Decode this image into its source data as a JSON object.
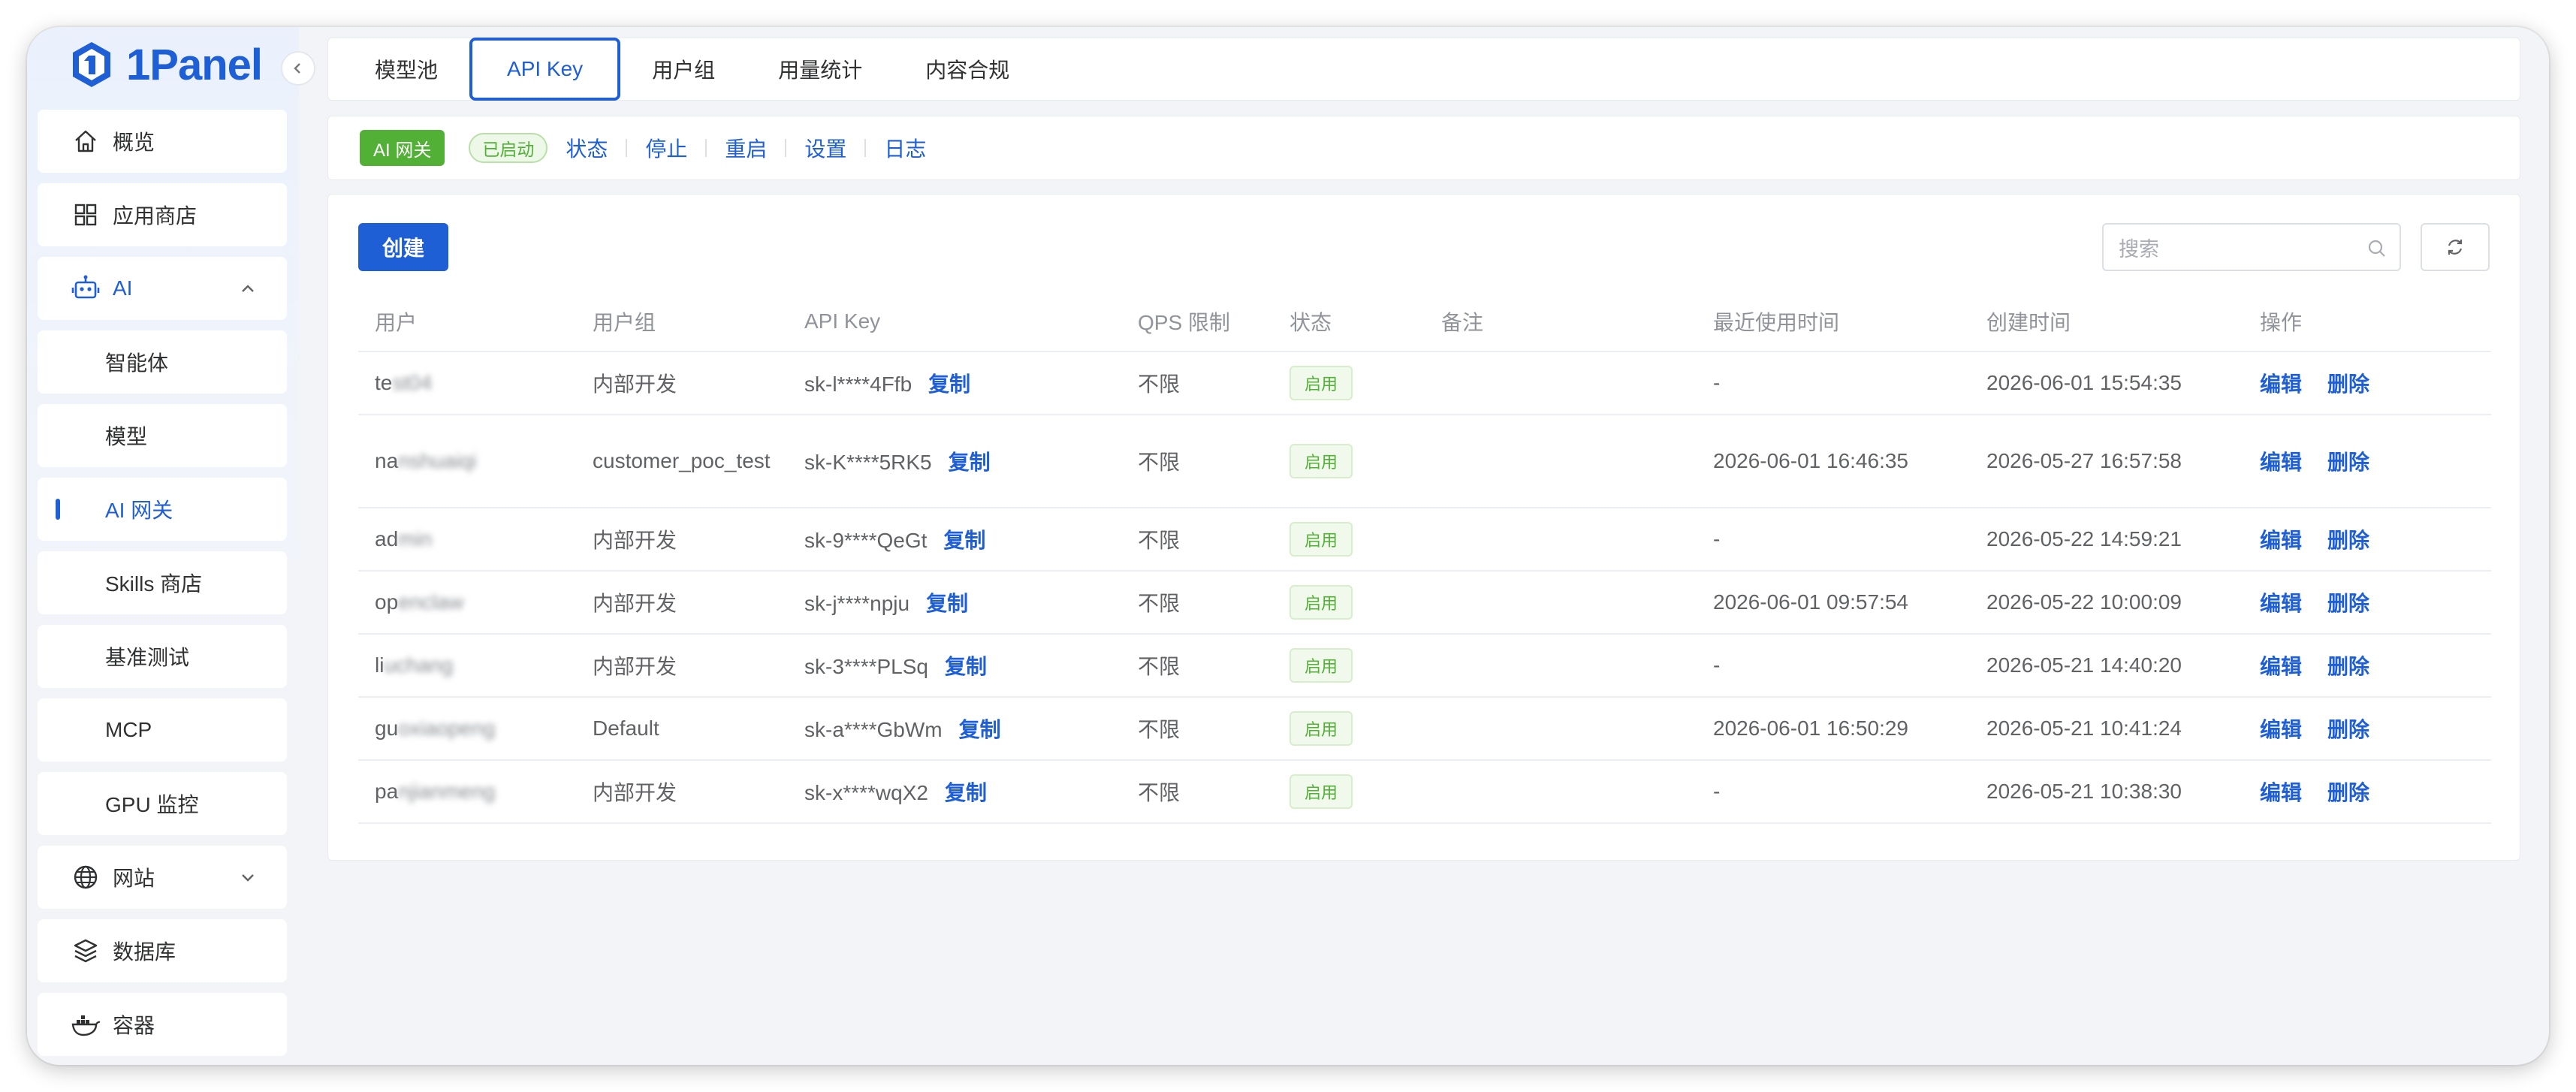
{
  "app": {
    "name": "1Panel",
    "brand_color": "#1f5fd6"
  },
  "sidebar": {
    "items": [
      {
        "label": "概览",
        "icon": "home-icon"
      },
      {
        "label": "应用商店",
        "icon": "grid-icon"
      },
      {
        "label": "AI",
        "icon": "robot-icon",
        "expanded": true
      },
      {
        "label": "智能体"
      },
      {
        "label": "模型"
      },
      {
        "label": "AI 网关",
        "active": true
      },
      {
        "label": "Skills 商店"
      },
      {
        "label": "基准测试"
      },
      {
        "label": "MCP"
      },
      {
        "label": "GPU 监控"
      },
      {
        "label": "网站",
        "icon": "globe-icon"
      },
      {
        "label": "数据库",
        "icon": "layers-icon"
      },
      {
        "label": "容器",
        "icon": "docker-icon"
      }
    ]
  },
  "tabs": [
    "模型池",
    "API Key",
    "用户组",
    "用量统计",
    "内容合规"
  ],
  "active_tab": "API Key",
  "gateway": {
    "tag": "AI 网关",
    "status": "已启动",
    "actions": [
      "状态",
      "停止",
      "重启",
      "设置",
      "日志"
    ]
  },
  "toolbar": {
    "create_label": "创建",
    "search_placeholder": "搜索"
  },
  "table": {
    "columns": [
      "用户",
      "用户组",
      "API Key",
      "QPS 限制",
      "状态",
      "备注",
      "最近使用时间",
      "创建时间",
      "操作"
    ],
    "copy_label": "复制",
    "edit_label": "编辑",
    "delete_label": "删除",
    "rows": [
      {
        "user_visible": "te",
        "user_blurred": "st04",
        "group": "内部开发",
        "key": "sk-l****4Ffb",
        "qps": "不限",
        "status": "启用",
        "note": "",
        "last_used": "-",
        "created": "2026-06-01 15:54:35"
      },
      {
        "user_visible": "na",
        "user_blurred": "nshuaiqi",
        "group": "customer_poc_test",
        "key": "sk-K****5RK5",
        "qps": "不限",
        "status": "启用",
        "note": "",
        "last_used": "2026-06-01 16:46:35",
        "created": "2026-05-27 16:57:58"
      },
      {
        "user_visible": "ad",
        "user_blurred": "min",
        "group": "内部开发",
        "key": "sk-9****QeGt",
        "qps": "不限",
        "status": "启用",
        "note": "",
        "last_used": "-",
        "created": "2026-05-22 14:59:21"
      },
      {
        "user_visible": "op",
        "user_blurred": "enclaw",
        "group": "内部开发",
        "key": "sk-j****npju",
        "qps": "不限",
        "status": "启用",
        "note": "",
        "last_used": "2026-06-01 09:57:54",
        "created": "2026-05-22 10:00:09"
      },
      {
        "user_visible": "li",
        "user_blurred": "uchang",
        "group": "内部开发",
        "key": "sk-3****PLSq",
        "qps": "不限",
        "status": "启用",
        "note": "",
        "last_used": "-",
        "created": "2026-05-21 14:40:20"
      },
      {
        "user_visible": "gu",
        "user_blurred": "oxiaopeng",
        "group": "Default",
        "key": "sk-a****GbWm",
        "qps": "不限",
        "status": "启用",
        "note": "",
        "last_used": "2026-06-01 16:50:29",
        "created": "2026-05-21 10:41:24"
      },
      {
        "user_visible": "pa",
        "user_blurred": "njianmeng",
        "group": "内部开发",
        "key": "sk-x****wqX2",
        "qps": "不限",
        "status": "启用",
        "note": "",
        "last_used": "-",
        "created": "2026-05-21 10:38:30"
      }
    ]
  }
}
